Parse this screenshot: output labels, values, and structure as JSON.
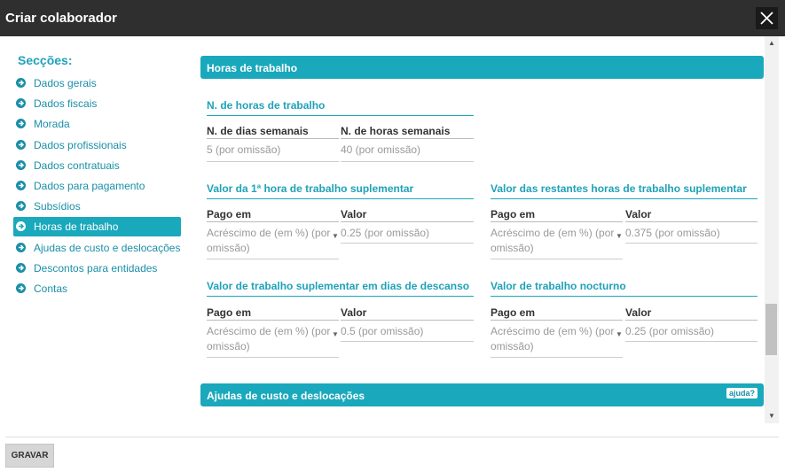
{
  "window": {
    "title": "Criar colaborador"
  },
  "sidebar": {
    "heading": "Secções:",
    "items": [
      {
        "label": "Dados gerais"
      },
      {
        "label": "Dados fiscais"
      },
      {
        "label": "Morada"
      },
      {
        "label": "Dados profissionais"
      },
      {
        "label": "Dados contratuais"
      },
      {
        "label": "Dados para pagamento"
      },
      {
        "label": "Subsídios"
      },
      {
        "label": "Horas de trabalho",
        "active": true
      },
      {
        "label": "Ajudas de custo e deslocações"
      },
      {
        "label": "Descontos para entidades"
      },
      {
        "label": "Contas"
      }
    ]
  },
  "main": {
    "panel1": {
      "title": "Horas de trabalho"
    },
    "hours": {
      "title": "N. de horas de trabalho",
      "days_label": "N. de dias semanais",
      "days_value": "5 (por omissão)",
      "hours_label": "N. de horas semanais",
      "hours_value": "40 (por omissão)"
    },
    "first_hour": {
      "title": "Valor da 1ª hora de trabalho suplementar",
      "pay_label": "Pago em",
      "pay_value": "Acréscimo de (em %) (por omissão)",
      "value_label": "Valor",
      "value_value": "0.25 (por omissão)"
    },
    "remaining": {
      "title": "Valor das restantes horas de trabalho suplementar",
      "pay_label": "Pago em",
      "pay_value": "Acréscimo de (em %) (por omissão)",
      "value_label": "Valor",
      "value_value": "0.375 (por omissão)"
    },
    "rest_days": {
      "title": "Valor de trabalho suplementar em dias de descanso",
      "pay_label": "Pago em",
      "pay_value": "Acréscimo de (em %) (por omissão)",
      "value_label": "Valor",
      "value_value": "0.5 (por omissão)"
    },
    "night": {
      "title": "Valor de trabalho nocturno",
      "pay_label": "Pago em",
      "pay_value": "Acréscimo de (em %) (por omissão)",
      "value_label": "Valor",
      "value_value": "0.25 (por omissão)"
    },
    "panel2": {
      "title": "Ajudas de custo e deslocações",
      "help": "ajuda?"
    }
  },
  "footer": {
    "save_label": "GRAVAR"
  },
  "colors": {
    "accent": "#1aa8bc",
    "titlebar": "#2f2f2f"
  },
  "icons": {
    "close": "close-icon",
    "nav": "arrow-circle-right-icon",
    "dropdown": "caret-down-icon"
  }
}
